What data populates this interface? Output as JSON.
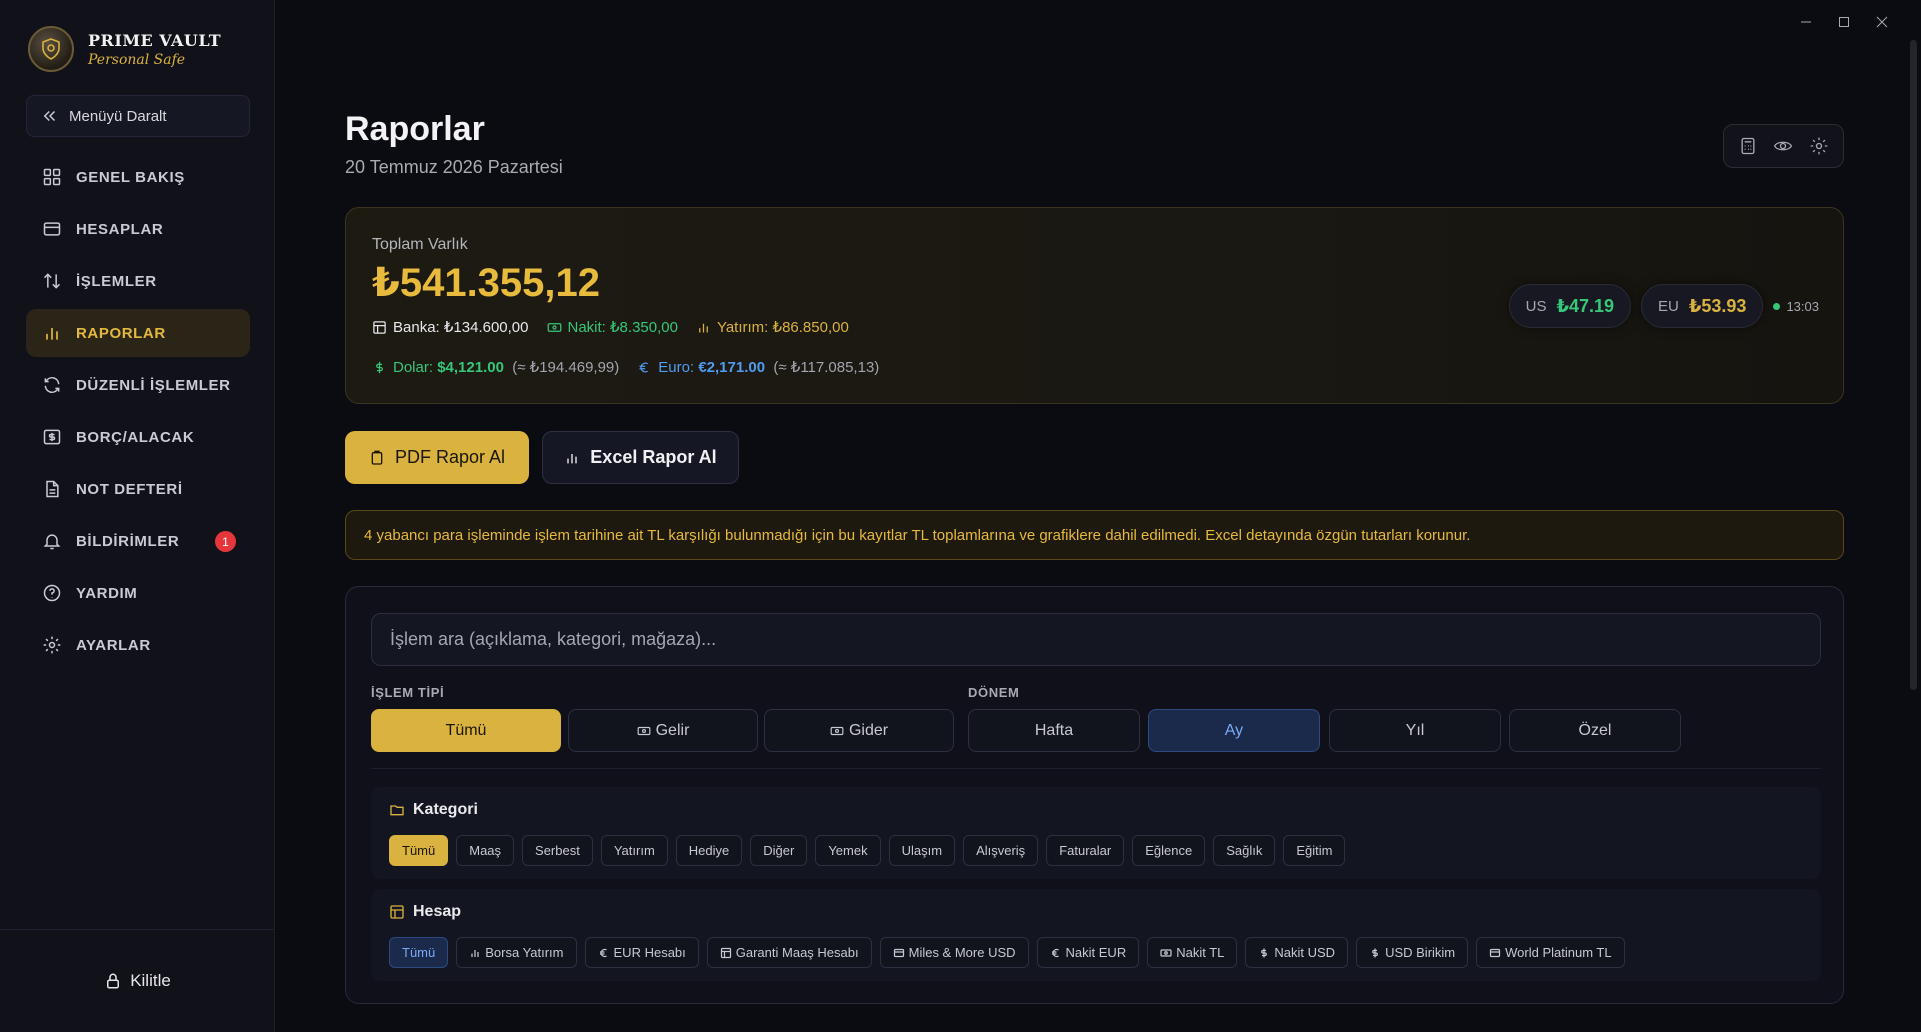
{
  "brand": {
    "title": "PRIME VAULT",
    "subtitle": "Personal Safe"
  },
  "sidebar": {
    "collapse_label": "Menüyü Daralt",
    "items": [
      {
        "label": "GENEL BAKIŞ",
        "icon": "grid-icon"
      },
      {
        "label": "HESAPLAR",
        "icon": "card-icon"
      },
      {
        "label": "İŞLEMLER",
        "icon": "arrows-updown-icon"
      },
      {
        "label": "RAPORLAR",
        "icon": "bar-chart-icon",
        "active": true
      },
      {
        "label": "DÜZENLİ İŞLEMLER",
        "icon": "refresh-icon"
      },
      {
        "label": "BORÇ/ALACAK",
        "icon": "money-icon"
      },
      {
        "label": "NOT DEFTERİ",
        "icon": "document-icon"
      },
      {
        "label": "BİLDİRİMLER",
        "icon": "bell-icon",
        "badge": "1"
      },
      {
        "label": "YARDIM",
        "icon": "help-icon"
      },
      {
        "label": "AYARLAR",
        "icon": "gear-icon"
      }
    ],
    "lock_label": "Kilitle"
  },
  "header": {
    "title": "Raporlar",
    "date": "20 Temmuz 2026 Pazartesi"
  },
  "summary": {
    "label": "Toplam Varlık",
    "total": "₺541.355,12",
    "bank_label": "Banka:",
    "bank_value": "₺134.600,00",
    "cash_label": "Nakit:",
    "cash_value": "₺8.350,00",
    "invest_label": "Yatırım:",
    "invest_value": "₺86.850,00",
    "usd_label": "Dolar:",
    "usd_value": "$4,121.00",
    "usd_try": "(≈ ₺194.469,99)",
    "eur_label": "Euro:",
    "eur_value": "€2,171.00",
    "eur_try": "(≈ ₺117.085,13)",
    "rates": [
      {
        "code": "US",
        "value": "₺47.19",
        "color": "#36c779"
      },
      {
        "code": "EU",
        "value": "₺53.93",
        "color": "#d9b23f"
      }
    ],
    "updated": "13:03"
  },
  "actions": {
    "pdf": "PDF Rapor Al",
    "excel": "Excel Rapor Al"
  },
  "warning": "4 yabancı para işleminde işlem tarihine ait TL karşılığı bulunmadığı için bu kayıtlar TL toplamlarına ve grafiklere dahil edilmedi. Excel detayında özgün tutarları korunur.",
  "filters": {
    "search_placeholder": "İşlem ara (açıklama, kategori, mağaza)...",
    "type_label": "İŞLEM TİPİ",
    "types": [
      "Tümü",
      "Gelir",
      "Gider"
    ],
    "period_label": "DÖNEM",
    "periods": [
      "Hafta",
      "Ay",
      "Yıl",
      "Özel"
    ],
    "category_title": "Kategori",
    "categories": [
      "Tümü",
      "Maaş",
      "Serbest",
      "Yatırım",
      "Hediye",
      "Diğer",
      "Yemek",
      "Ulaşım",
      "Alışveriş",
      "Faturalar",
      "Eğlence",
      "Sağlık",
      "Eğitim"
    ],
    "account_title": "Hesap",
    "accounts": [
      "Tümü",
      "Borsa Yatırım",
      "EUR Hesabı",
      "Garanti Maaş Hesabı",
      "Miles & More USD",
      "Nakit EUR",
      "Nakit TL",
      "Nakit USD",
      "USD Birikim",
      "World Platinum TL"
    ]
  }
}
